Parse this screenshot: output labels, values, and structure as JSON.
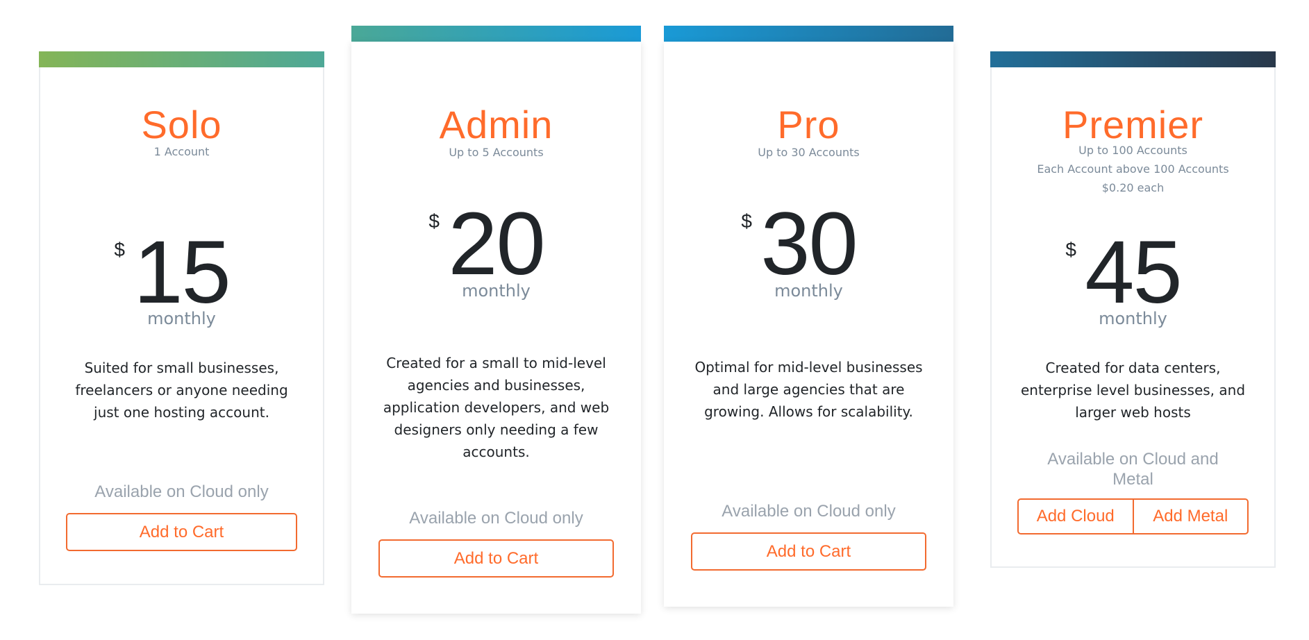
{
  "colors": {
    "accent": "#ff6b2b",
    "text_dark": "#212529",
    "text_muted": "#7b8a99",
    "border": "#e9ecef"
  },
  "plans": [
    {
      "name": "Solo",
      "subtitle": [
        "1 Account"
      ],
      "currency": "$",
      "price": "15",
      "period": "monthly",
      "description": "Suited for small businesses, freelancers or anyone needing just one hosting account.",
      "availability": "Available on Cloud only",
      "buttons": [
        "Add to Cart"
      ],
      "bar_gradient": [
        "#84b557",
        "#4ea897"
      ]
    },
    {
      "name": "Admin",
      "subtitle": [
        "Up to 5 Accounts"
      ],
      "currency": "$",
      "price": "20",
      "period": "monthly",
      "description": "Created for a small to mid-level agencies and businesses, application developers, and web designers only needing a few accounts.",
      "availability": "Available on Cloud only",
      "buttons": [
        "Add to Cart"
      ],
      "bar_gradient": [
        "#4aa897",
        "#1a9ad6"
      ]
    },
    {
      "name": "Pro",
      "subtitle": [
        "Up to 30 Accounts"
      ],
      "currency": "$",
      "price": "30",
      "period": "monthly",
      "description": "Optimal for mid-level businesses and large agencies that are growing. Allows for scalability.",
      "availability": "Available on Cloud only",
      "buttons": [
        "Add to Cart"
      ],
      "bar_gradient": [
        "#1a9ad6",
        "#226c96"
      ]
    },
    {
      "name": "Premier",
      "subtitle": [
        "Up to 100 Accounts",
        "Each Account above 100 Accounts",
        "$0.20 each"
      ],
      "currency": "$",
      "price": "45",
      "period": "monthly",
      "description": "Created for data centers, enterprise level businesses, and larger web hosts",
      "availability": "Available on Cloud and Metal",
      "buttons": [
        "Add Cloud",
        "Add Metal"
      ],
      "bar_gradient": [
        "#226f99",
        "#29384a"
      ]
    }
  ]
}
